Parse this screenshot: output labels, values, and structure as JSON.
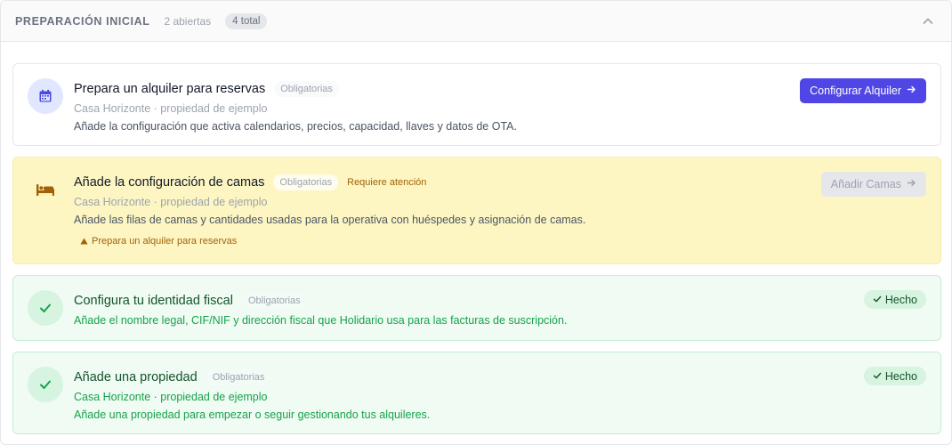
{
  "header": {
    "title": "PREPARACIÓN INICIAL",
    "open_count": "2 abiertas",
    "total_count": "4 total"
  },
  "colors": {
    "accent": "#4f46e5",
    "attention_bg": "#fdf6c3",
    "done_bg": "#effbf3",
    "done_text": "#16a34a"
  },
  "tasks": [
    {
      "icon": "calendar-icon",
      "title": "Prepara un alquiler para reservas",
      "badge": "Obligatorias",
      "subtitle": "Casa Horizonte · propiedad de ejemplo",
      "description": "Añade la configuración que activa calendarios, precios, capacidad, llaves y datos de OTA.",
      "action_label": "Configurar Alquiler",
      "status": "pending"
    },
    {
      "icon": "bed-icon",
      "title": "Añade la configuración de camas",
      "badge": "Obligatorias",
      "attention_label": "Requiere atención",
      "subtitle": "Casa Horizonte · propiedad de ejemplo",
      "description": "Añade las filas de camas y cantidades usadas para la operativa con huéspedes y asignación de camas.",
      "requirement": "Prepara un alquiler para reservas",
      "action_label": "Añadir Camas",
      "status": "blocked"
    },
    {
      "icon": "check-icon",
      "title": "Configura tu identidad fiscal",
      "badge": "Obligatorias",
      "description": "Añade el nombre legal, CIF/NIF y dirección fiscal que Holidario usa para las facturas de suscripción.",
      "done_label": "Hecho",
      "status": "done"
    },
    {
      "icon": "check-icon",
      "title": "Añade una propiedad",
      "badge": "Obligatorias",
      "subtitle": "Casa Horizonte · propiedad de ejemplo",
      "description": "Añade una propiedad para empezar o seguir gestionando tus alquileres.",
      "done_label": "Hecho",
      "status": "done"
    }
  ]
}
